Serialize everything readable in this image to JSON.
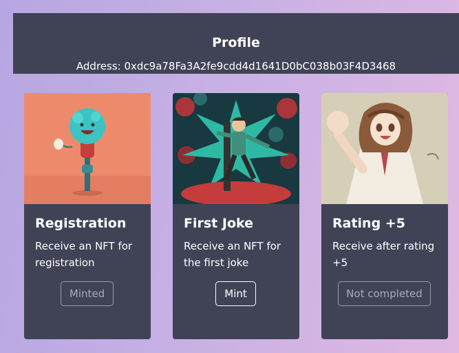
{
  "profile": {
    "title": "Profile",
    "address": "Address: 0xdc9a78Fa3A2fe9cdd4d1641D0bC038b03F4D3468"
  },
  "cards": [
    {
      "title": "Registration",
      "description": "Receive an NFT for registration",
      "button_label": "Minted",
      "image": "microphone-mascot-illustration"
    },
    {
      "title": "First Joke",
      "description": "Receive an NFT for the first joke",
      "button_label": "Mint",
      "image": "comedian-on-stage-illustration"
    },
    {
      "title": "Rating +5",
      "description": "Receive after rating +5",
      "button_label": "Not completed",
      "image": "anime-girl-waving-illustration"
    }
  ],
  "colors": {
    "panel": "#404356",
    "text": "#ffffff",
    "button_disabled_text": "#a9abb8"
  }
}
